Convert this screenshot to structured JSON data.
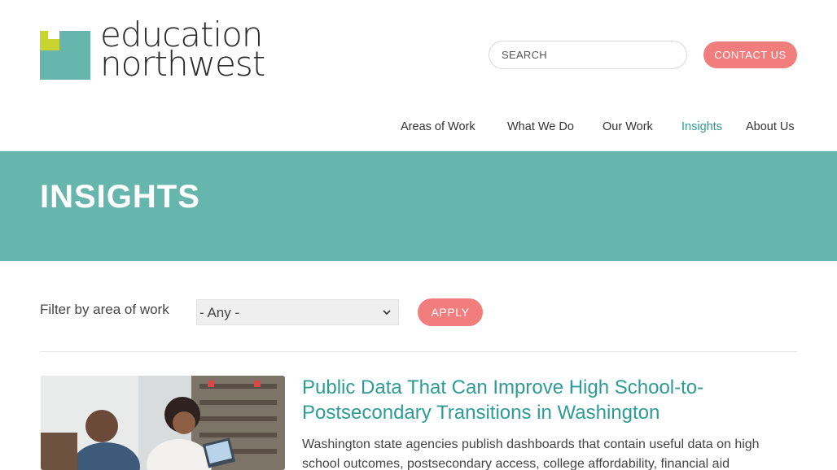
{
  "logo": {
    "line1": "education",
    "line2": "northwest",
    "colors": {
      "lime": "#c8d42f",
      "teal": "#66b6ad"
    }
  },
  "search": {
    "placeholder": "SEARCH"
  },
  "contact": {
    "label": "CONTACT US"
  },
  "nav": {
    "items": [
      {
        "label": "Areas of Work"
      },
      {
        "label": "What We Do"
      },
      {
        "label": "Our Work"
      },
      {
        "label": "Insights",
        "active": true
      },
      {
        "label": "About Us"
      }
    ]
  },
  "banner": {
    "title": "INSIGHTS"
  },
  "filter": {
    "label": "Filter by area of work",
    "selected": "- Any -",
    "apply_label": "APPLY"
  },
  "article": {
    "title": "Public Data That Can Improve High School-to-Postsecondary Transitions in Washington",
    "description": "Washington state agencies publish dashboards that contain useful data on high school outcomes, postsecondary access, college affordability, financial aid"
  },
  "colors": {
    "accent": "#f27d7d",
    "banner": "#66b6ad",
    "link": "#2e9b95"
  }
}
